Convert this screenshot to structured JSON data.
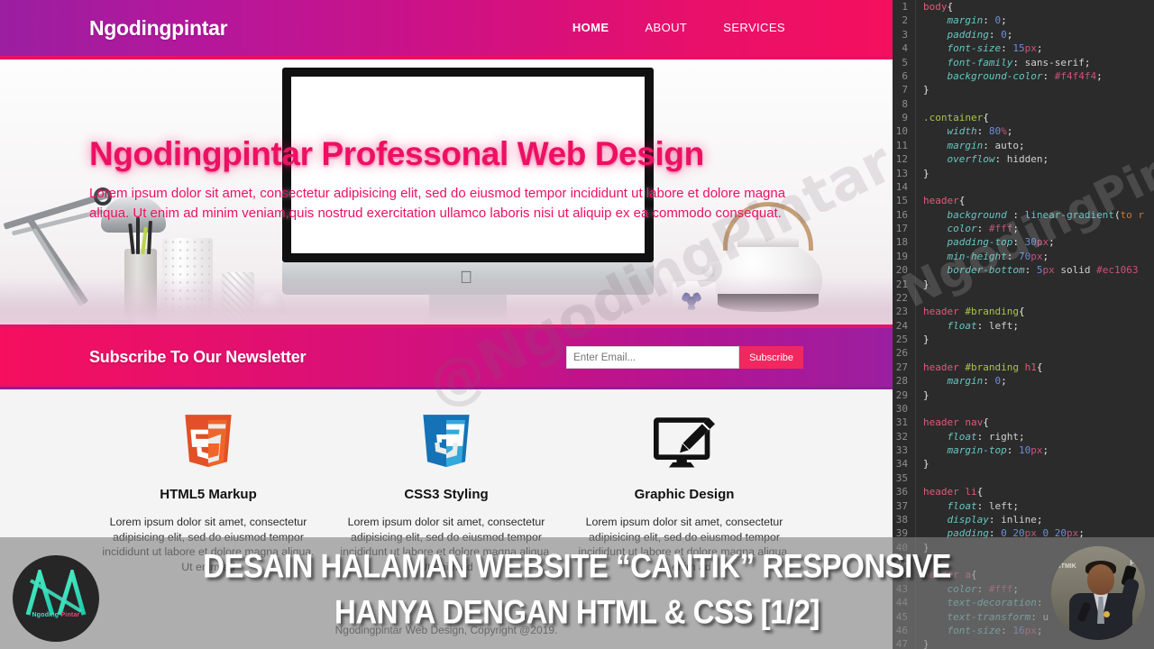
{
  "video_overlay": {
    "title_line1": "DESAIN HALAMAN WEBSITE “CANTIK” RESPONSIVE",
    "title_line2": "HANYA DENGAN HTML & CSS [1/2]",
    "logo_text_a": "Ngoding",
    "logo_text_b": "Pintar",
    "watermark_preview": "@NgodingPintar",
    "watermark_editor": "NgodingPintar",
    "presenter_banner_line1": "STMIK",
    "presenter_banner_line2": "PE"
  },
  "site": {
    "header": {
      "brand": "Ngodingpintar",
      "nav": [
        {
          "label": "HOME",
          "active": true
        },
        {
          "label": "ABOUT",
          "active": false
        },
        {
          "label": "SERVICES",
          "active": false
        }
      ]
    },
    "hero": {
      "heading": "Ngodingpintar Professonal Web Design",
      "paragraph": "Lorem ipsum dolor sit amet, consectetur adipisicing elit, sed do eiusmod tempor incididunt ut labore et dolore magna aliqua. Ut enim ad minim veniam,quis nostrud exercitation ullamco laboris nisi ut aliquip ex ea commodo consequat."
    },
    "newsletter": {
      "heading": "Subscribe To Our Newsletter",
      "email_placeholder": "Enter Email...",
      "email_value": "",
      "button_label": "Subscribe"
    },
    "boxes": [
      {
        "icon": "html5-shield-icon",
        "title": "HTML5 Markup",
        "text": "Lorem ipsum dolor sit amet, consectetur adipisicing elit, sed do eiusmod tempor incididunt ut labore et dolore magna aliqua. Ut enim ad"
      },
      {
        "icon": "css3-shield-icon",
        "title": "CSS3 Styling",
        "text": "Lorem ipsum dolor sit amet, consectetur adipisicing elit, sed do eiusmod tempor incididunt ut labore et dolore magna aliqua. Ut enim ad"
      },
      {
        "icon": "graphic-design-icon",
        "title": "Graphic Design",
        "text": "Lorem ipsum dolor sit amet, consectetur adipisicing elit, sed do eiusmod tempor incididunt ut labore et dolore magna aliqua. Ut enim ad"
      }
    ],
    "footer": "Ngodingpintar Web Design, Copyright @2019."
  },
  "editor": {
    "language": "css",
    "lines": [
      {
        "n": 1,
        "tokens": [
          {
            "t": "tag",
            "v": "body"
          },
          {
            "t": "brace",
            "v": "{"
          }
        ]
      },
      {
        "n": 2,
        "tokens": [
          {
            "t": "prop",
            "v": "    margin"
          },
          {
            "t": "punc",
            "v": ": "
          },
          {
            "t": "num",
            "v": "0"
          },
          {
            "t": "punc",
            "v": ";"
          }
        ]
      },
      {
        "n": 3,
        "tokens": [
          {
            "t": "prop",
            "v": "    padding"
          },
          {
            "t": "punc",
            "v": ": "
          },
          {
            "t": "num",
            "v": "0"
          },
          {
            "t": "punc",
            "v": ";"
          }
        ]
      },
      {
        "n": 4,
        "tokens": [
          {
            "t": "prop",
            "v": "    font-size"
          },
          {
            "t": "punc",
            "v": ": "
          },
          {
            "t": "num",
            "v": "15"
          },
          {
            "t": "unit",
            "v": "px"
          },
          {
            "t": "punc",
            "v": ";"
          }
        ]
      },
      {
        "n": 5,
        "tokens": [
          {
            "t": "prop",
            "v": "    font-family"
          },
          {
            "t": "punc",
            "v": ": "
          },
          {
            "t": "val",
            "v": "sans-serif"
          },
          {
            "t": "punc",
            "v": ";"
          }
        ]
      },
      {
        "n": 6,
        "tokens": [
          {
            "t": "prop",
            "v": "    background-color"
          },
          {
            "t": "punc",
            "v": ": "
          },
          {
            "t": "hex",
            "v": "#f4f4f4"
          },
          {
            "t": "punc",
            "v": ";"
          }
        ]
      },
      {
        "n": 7,
        "tokens": [
          {
            "t": "brace",
            "v": "}"
          }
        ]
      },
      {
        "n": 8,
        "tokens": []
      },
      {
        "n": 9,
        "tokens": [
          {
            "t": "class",
            "v": ".container"
          },
          {
            "t": "brace",
            "v": "{"
          }
        ]
      },
      {
        "n": 10,
        "tokens": [
          {
            "t": "prop",
            "v": "    width"
          },
          {
            "t": "punc",
            "v": ": "
          },
          {
            "t": "num",
            "v": "80"
          },
          {
            "t": "unit",
            "v": "%"
          },
          {
            "t": "punc",
            "v": ";"
          }
        ]
      },
      {
        "n": 11,
        "tokens": [
          {
            "t": "prop",
            "v": "    margin"
          },
          {
            "t": "punc",
            "v": ": "
          },
          {
            "t": "val",
            "v": "auto"
          },
          {
            "t": "punc",
            "v": ";"
          }
        ]
      },
      {
        "n": 12,
        "tokens": [
          {
            "t": "prop",
            "v": "    overflow"
          },
          {
            "t": "punc",
            "v": ": "
          },
          {
            "t": "val",
            "v": "hidden"
          },
          {
            "t": "punc",
            "v": ";"
          }
        ]
      },
      {
        "n": 13,
        "tokens": [
          {
            "t": "brace",
            "v": "}"
          }
        ]
      },
      {
        "n": 14,
        "tokens": []
      },
      {
        "n": 15,
        "tokens": [
          {
            "t": "tag",
            "v": "header"
          },
          {
            "t": "brace",
            "v": "{"
          }
        ]
      },
      {
        "n": 16,
        "tokens": [
          {
            "t": "prop",
            "v": "    background"
          },
          {
            "t": "punc",
            "v": " : "
          },
          {
            "t": "func",
            "v": "linear-gradient"
          },
          {
            "t": "punc",
            "v": "("
          },
          {
            "t": "kw",
            "v": "to r"
          }
        ]
      },
      {
        "n": 17,
        "tokens": [
          {
            "t": "prop",
            "v": "    color"
          },
          {
            "t": "punc",
            "v": ": "
          },
          {
            "t": "hex",
            "v": "#fff"
          },
          {
            "t": "punc",
            "v": ";"
          }
        ]
      },
      {
        "n": 18,
        "tokens": [
          {
            "t": "prop",
            "v": "    padding-top"
          },
          {
            "t": "punc",
            "v": ": "
          },
          {
            "t": "num",
            "v": "30"
          },
          {
            "t": "unit",
            "v": "px"
          },
          {
            "t": "punc",
            "v": ";"
          }
        ]
      },
      {
        "n": 19,
        "tokens": [
          {
            "t": "prop",
            "v": "    min-height"
          },
          {
            "t": "punc",
            "v": ": "
          },
          {
            "t": "num",
            "v": "70"
          },
          {
            "t": "unit",
            "v": "px"
          },
          {
            "t": "punc",
            "v": ";"
          }
        ]
      },
      {
        "n": 20,
        "tokens": [
          {
            "t": "prop",
            "v": "    border-bottom"
          },
          {
            "t": "punc",
            "v": ": "
          },
          {
            "t": "num",
            "v": "5"
          },
          {
            "t": "unit",
            "v": "px"
          },
          {
            "t": "val",
            "v": " solid "
          },
          {
            "t": "hex",
            "v": "#ec1063"
          }
        ]
      },
      {
        "n": 21,
        "tokens": [
          {
            "t": "brace",
            "v": "}"
          }
        ]
      },
      {
        "n": 22,
        "tokens": []
      },
      {
        "n": 23,
        "tokens": [
          {
            "t": "tag",
            "v": "header "
          },
          {
            "t": "class",
            "v": "#branding"
          },
          {
            "t": "brace",
            "v": "{"
          }
        ]
      },
      {
        "n": 24,
        "tokens": [
          {
            "t": "prop",
            "v": "    float"
          },
          {
            "t": "punc",
            "v": ": "
          },
          {
            "t": "val",
            "v": "left"
          },
          {
            "t": "punc",
            "v": ";"
          }
        ]
      },
      {
        "n": 25,
        "tokens": [
          {
            "t": "brace",
            "v": "}"
          }
        ]
      },
      {
        "n": 26,
        "tokens": []
      },
      {
        "n": 27,
        "tokens": [
          {
            "t": "tag",
            "v": "header "
          },
          {
            "t": "class",
            "v": "#branding "
          },
          {
            "t": "tag",
            "v": "h1"
          },
          {
            "t": "brace",
            "v": "{"
          }
        ]
      },
      {
        "n": 28,
        "tokens": [
          {
            "t": "prop",
            "v": "    margin"
          },
          {
            "t": "punc",
            "v": ": "
          },
          {
            "t": "num",
            "v": "0"
          },
          {
            "t": "punc",
            "v": ";"
          }
        ]
      },
      {
        "n": 29,
        "tokens": [
          {
            "t": "brace",
            "v": "}"
          }
        ]
      },
      {
        "n": 30,
        "tokens": []
      },
      {
        "n": 31,
        "tokens": [
          {
            "t": "tag",
            "v": "header nav"
          },
          {
            "t": "brace",
            "v": "{"
          }
        ]
      },
      {
        "n": 32,
        "tokens": [
          {
            "t": "prop",
            "v": "    float"
          },
          {
            "t": "punc",
            "v": ": "
          },
          {
            "t": "val",
            "v": "right"
          },
          {
            "t": "punc",
            "v": ";"
          }
        ]
      },
      {
        "n": 33,
        "tokens": [
          {
            "t": "prop",
            "v": "    margin-top"
          },
          {
            "t": "punc",
            "v": ": "
          },
          {
            "t": "num",
            "v": "10"
          },
          {
            "t": "unit",
            "v": "px"
          },
          {
            "t": "punc",
            "v": ";"
          }
        ]
      },
      {
        "n": 34,
        "tokens": [
          {
            "t": "brace",
            "v": "}"
          }
        ]
      },
      {
        "n": 35,
        "tokens": []
      },
      {
        "n": 36,
        "tokens": [
          {
            "t": "tag",
            "v": "header li"
          },
          {
            "t": "brace",
            "v": "{"
          }
        ]
      },
      {
        "n": 37,
        "tokens": [
          {
            "t": "prop",
            "v": "    float"
          },
          {
            "t": "punc",
            "v": ": "
          },
          {
            "t": "val",
            "v": "left"
          },
          {
            "t": "punc",
            "v": ";"
          }
        ]
      },
      {
        "n": 38,
        "tokens": [
          {
            "t": "prop",
            "v": "    display"
          },
          {
            "t": "punc",
            "v": ": "
          },
          {
            "t": "val",
            "v": "inline"
          },
          {
            "t": "punc",
            "v": ";"
          }
        ]
      },
      {
        "n": 39,
        "tokens": [
          {
            "t": "prop",
            "v": "    padding"
          },
          {
            "t": "punc",
            "v": ": "
          },
          {
            "t": "num",
            "v": "0 20"
          },
          {
            "t": "unit",
            "v": "px"
          },
          {
            "t": "num",
            "v": " 0 20"
          },
          {
            "t": "unit",
            "v": "px"
          },
          {
            "t": "punc",
            "v": ";"
          }
        ]
      },
      {
        "n": 40,
        "tokens": [
          {
            "t": "brace",
            "v": "}"
          }
        ]
      },
      {
        "n": 41,
        "tokens": []
      },
      {
        "n": 42,
        "tokens": [
          {
            "t": "tag",
            "v": "header a"
          },
          {
            "t": "brace",
            "v": "{"
          }
        ]
      },
      {
        "n": 43,
        "tokens": [
          {
            "t": "prop",
            "v": "    color"
          },
          {
            "t": "punc",
            "v": ": "
          },
          {
            "t": "hex",
            "v": "#fff"
          },
          {
            "t": "punc",
            "v": ";"
          }
        ]
      },
      {
        "n": 44,
        "tokens": [
          {
            "t": "prop",
            "v": "    text-decoration"
          },
          {
            "t": "punc",
            "v": ": "
          }
        ]
      },
      {
        "n": 45,
        "tokens": [
          {
            "t": "prop",
            "v": "    text-transform"
          },
          {
            "t": "punc",
            "v": ": "
          },
          {
            "t": "val",
            "v": "u"
          }
        ]
      },
      {
        "n": 46,
        "tokens": [
          {
            "t": "prop",
            "v": "    font-size"
          },
          {
            "t": "punc",
            "v": ": "
          },
          {
            "t": "num",
            "v": "16"
          },
          {
            "t": "unit",
            "v": "px"
          },
          {
            "t": "punc",
            "v": ";"
          }
        ]
      },
      {
        "n": 47,
        "tokens": [
          {
            "t": "brace",
            "v": "}"
          }
        ]
      }
    ]
  }
}
